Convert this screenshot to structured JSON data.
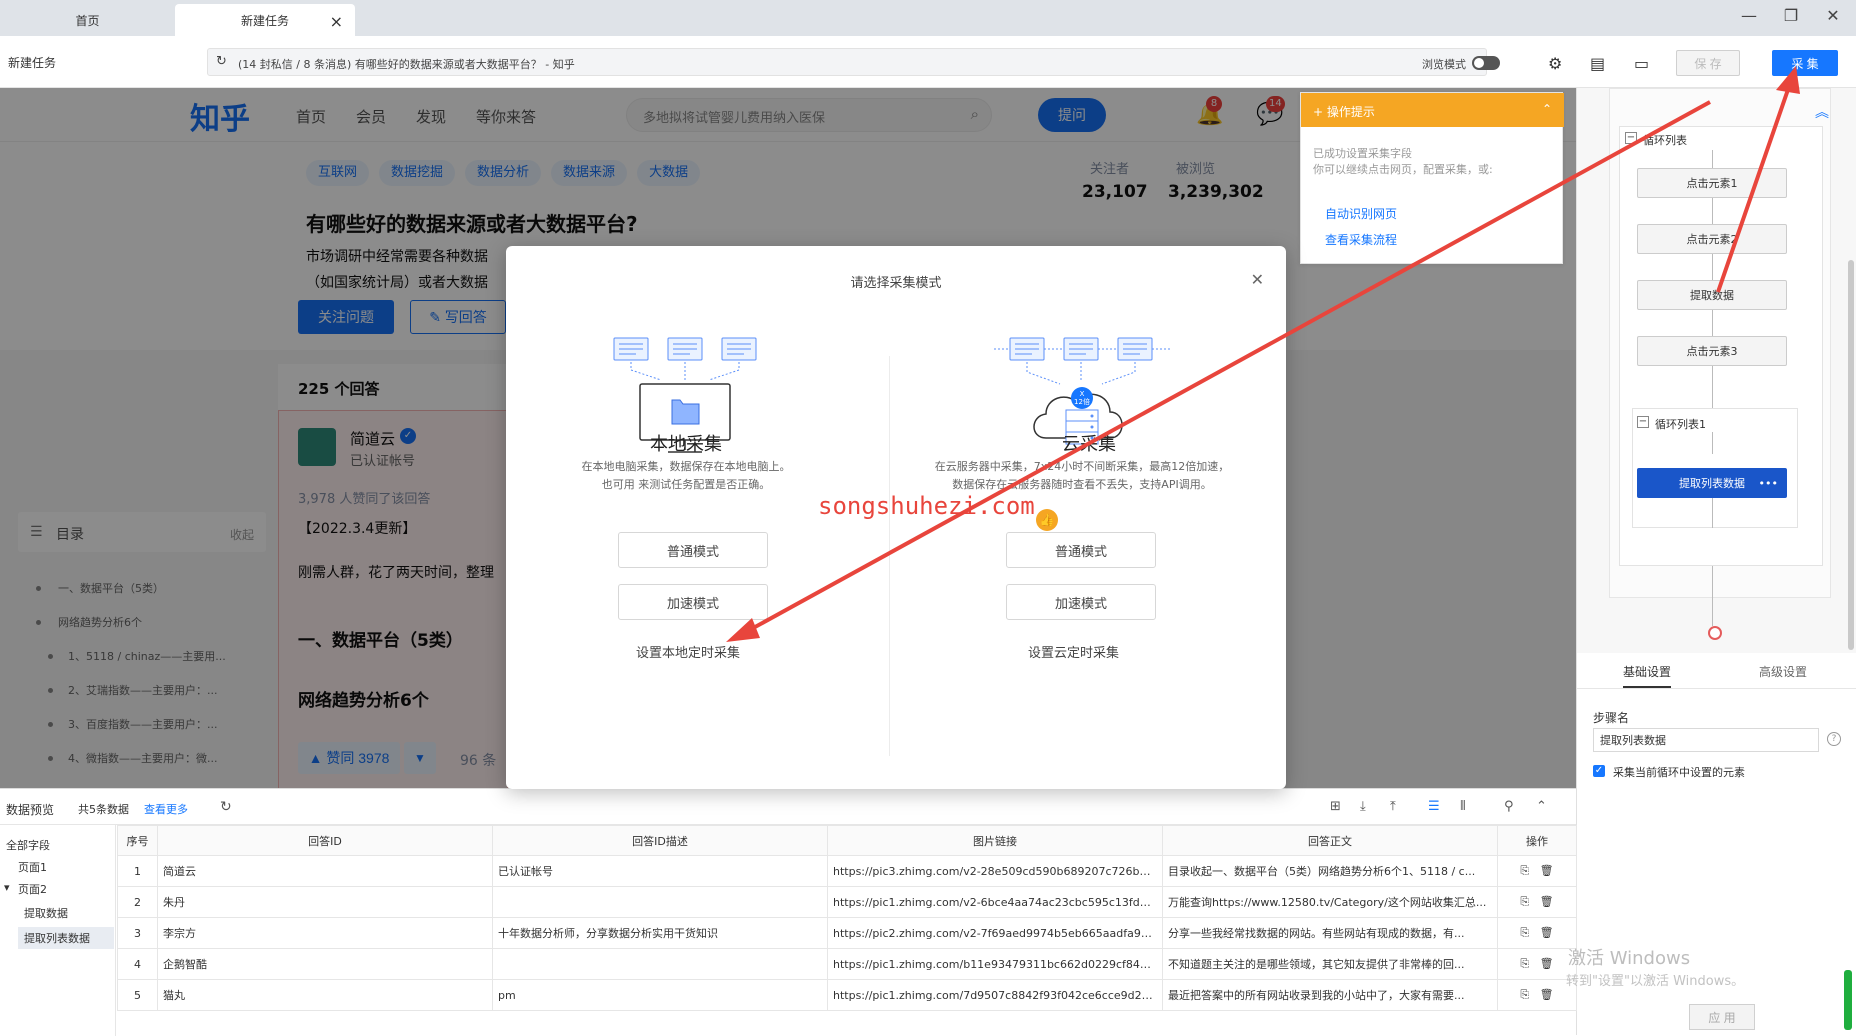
{
  "tabs": [
    {
      "label": "首页"
    },
    {
      "label": "新建任务"
    }
  ],
  "toolbar": {
    "task_label": "新建任务",
    "url_text": "(14 封私信 / 8 条消息) 有哪些好的数据来源或者大数据平台？ - 知乎",
    "browse_mode_label": "浏览模式",
    "save_label": "保 存",
    "collect_label": "采 集"
  },
  "zhihu": {
    "logo": "知乎",
    "nav": [
      "首页",
      "会员",
      "发现",
      "等你来答"
    ],
    "search_placeholder": "多地拟将试管婴儿费用纳入医保",
    "ask_label": "提问",
    "notif_badge": "8",
    "msg_badge": "14",
    "topics": [
      "互联网",
      "数据挖掘",
      "数据分析",
      "数据来源",
      "大数据"
    ],
    "followers_label": "关注者",
    "followers_value": "23,107",
    "views_label": "被浏览",
    "views_value": "3,239,302",
    "question_title": "有哪些好的数据来源或者大数据平台?",
    "question_desc_1": "市场调研中经常需要各种数据",
    "question_desc_2": "（如国家统计局）或者大数据",
    "follow_label": "关注问题",
    "write_label": "写回答",
    "answer_count": "225 个回答",
    "author_name": "简道云",
    "author_desc": "已认证帐号",
    "agree_text": "3,978 人赞同了该回答",
    "ans_line_1": "【2022.3.4更新】",
    "ans_line_2": "刚需人群，花了两天时间，整理",
    "ans_head_1": "一、数据平台（5类）",
    "ans_head_2": "网络趋势分析6个",
    "upvote_label": "▲ 赞同 3978",
    "comment_count": "96 条",
    "toc": {
      "title": "目录",
      "collapse": "收起",
      "items": [
        "一、数据平台（5类）",
        "网络趋势分析6个",
        "1、5118 / chinaz——主要用...",
        "2、艾瑞指数——主要用户：...",
        "3、百度指数——主要用户：...",
        "4、微指数——主要用户：微..."
      ]
    }
  },
  "op_tip": {
    "title": "操作提示",
    "msg_1": "已成功设置采集字段",
    "msg_2": "你可以继续点击网页，配置采集，或:",
    "link_1": "自动识别网页",
    "link_2": "查看采集流程"
  },
  "modal": {
    "title": "请选择采集模式",
    "local": {
      "title": "本地采集",
      "desc_1": "在本地电脑采集，数据保存在本地电脑上。",
      "desc_2": "也可用 来测试任务配置是否正确。",
      "normal": "普通模式",
      "fast": "加速模式",
      "schedule": "设置本地定时采集"
    },
    "cloud": {
      "title": "云采集",
      "badge": "12倍",
      "desc_1": "在云服务器中采集，7x24小时不间断采集，最高12倍加速，",
      "desc_2": "数据保存在云服务器随时查看不丢失，支持API调用。",
      "normal": "普通模式",
      "fast": "加速模式",
      "schedule": "设置云定时采集"
    },
    "watermark": "songshuhezi.com"
  },
  "flow": {
    "loop_list": "循环列表",
    "nodes": [
      "点击元素1",
      "点击元素2",
      "提取数据",
      "点击元素3"
    ],
    "loop_list_1": "循环列表1",
    "active_node": "提取列表数据",
    "active_more": "•••"
  },
  "settings": {
    "tab_basic": "基础设置",
    "tab_advanced": "高级设置",
    "step_name_label": "步骤名",
    "step_name_value": "提取列表数据",
    "collect_in_loop": "采集当前循环中设置的元素",
    "apply": "应 用"
  },
  "preview": {
    "title": "数据预览",
    "count": "共5条数据",
    "more": "查看更多",
    "tree": [
      "全部字段",
      "页面1",
      "页面2",
      "提取数据",
      "提取列表数据"
    ],
    "columns": [
      "序号",
      "回答ID",
      "回答ID描述",
      "图片链接",
      "回答正文",
      "操作"
    ],
    "rows": [
      [
        "1",
        "简道云",
        "已认证帐号",
        "https://pic3.zhimg.com/v2-28e509cd590b689207c726b970f...",
        "目录收起一、数据平台（5类）网络趋势分析6个1、5118 / c..."
      ],
      [
        "2",
        "朱丹",
        "",
        "https://pic1.zhimg.com/v2-6bce4aa74ac23cbc595c13fd6b1...",
        "万能查询https://www.12580.tv/Category/这个网站收集汇总..."
      ],
      [
        "3",
        "李宗方",
        "十年数据分析师，分享数据分析实用干货知识",
        "https://pic2.zhimg.com/v2-7f69aed9974b5eb665aadfa935e...",
        "分享一些我经常找数据的网站。有些网站有现成的数据，有..."
      ],
      [
        "4",
        "企鹅智酷",
        "",
        "https://pic1.zhimg.com/b11e93479311bc662d0229cf84dde...",
        "不知道题主关注的是哪些领域，其它知友提供了非常棒的回..."
      ],
      [
        "5",
        "猫丸",
        "pm",
        "https://pic1.zhimg.com/7d9507c8842f93f042ce6cce9d202fa...",
        "最近把答案中的所有网站收录到我的小站中了，大家有需要..."
      ]
    ]
  },
  "windows": {
    "activate": "激活 Windows",
    "activate_sub": "转到\"设置\"以激活 Windows。"
  }
}
